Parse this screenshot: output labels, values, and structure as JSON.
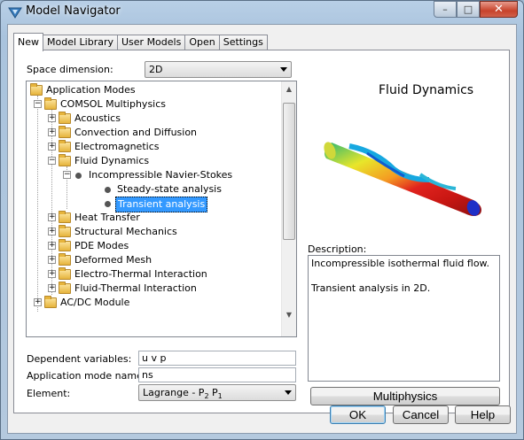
{
  "window": {
    "title": "Model Navigator"
  },
  "title_buttons": {
    "minimize": "–",
    "maximize": "□",
    "close": "✕"
  },
  "tabs": [
    {
      "label": "New",
      "active": true
    },
    {
      "label": "Model Library"
    },
    {
      "label": "User Models"
    },
    {
      "label": "Open"
    },
    {
      "label": "Settings"
    }
  ],
  "space_dimension": {
    "label": "Space dimension:",
    "value": "2D"
  },
  "tree": {
    "items": [
      {
        "label": "Application Modes"
      },
      {
        "label": "COMSOL Multiphysics",
        "expander": "−"
      },
      {
        "label": "Acoustics",
        "expander": "+"
      },
      {
        "label": "Convection and Diffusion",
        "expander": "+"
      },
      {
        "label": "Electromagnetics",
        "expander": "+"
      },
      {
        "label": "Fluid Dynamics",
        "expander": "−"
      },
      {
        "label": "Incompressible Navier-Stokes",
        "expander": "−"
      },
      {
        "label": "Steady-state analysis"
      },
      {
        "label": "Transient analysis",
        "selected": true
      },
      {
        "label": "Heat Transfer",
        "expander": "+"
      },
      {
        "label": "Structural Mechanics",
        "expander": "+"
      },
      {
        "label": "PDE Modes",
        "expander": "+"
      },
      {
        "label": "Deformed Mesh",
        "expander": "+"
      },
      {
        "label": "Electro-Thermal Interaction",
        "expander": "+"
      },
      {
        "label": "Fluid-Thermal Interaction",
        "expander": "+"
      },
      {
        "label": "AC/DC Module",
        "expander": "+"
      }
    ]
  },
  "preview": {
    "title": "Fluid Dynamics"
  },
  "description": {
    "label": "Description:",
    "line1": "Incompressible isothermal fluid flow.",
    "line2": "Transient analysis in 2D."
  },
  "dependent_variables": {
    "label": "Dependent variables:",
    "value": "u v p"
  },
  "application_mode_name": {
    "label": "Application mode name:",
    "value": "ns"
  },
  "element": {
    "label": "Element:",
    "value_main": "Lagrange - P",
    "sub1": "2",
    "mid": " P",
    "sub2": "1"
  },
  "buttons": {
    "multiphysics": "Multiphysics",
    "ok": "OK",
    "cancel": "Cancel",
    "help": "Help"
  }
}
